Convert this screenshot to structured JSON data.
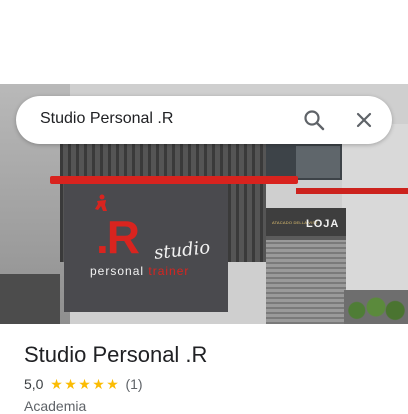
{
  "search": {
    "query": "Studio Personal .R"
  },
  "photo": {
    "logo": {
      "letter": ".R",
      "studio": "studio",
      "personal": "personal",
      "trainer": "trainer"
    },
    "store": {
      "small_sign": "ATACADO DELLA VIST",
      "name": "LOJA"
    }
  },
  "place": {
    "name": "Studio Personal .R",
    "rating": "5,0",
    "stars": 5,
    "star_glyph": "★",
    "review_count": "(1)",
    "category": "Academia"
  },
  "colors": {
    "star": "#fbbc04",
    "accent_red": "#d9241f"
  }
}
